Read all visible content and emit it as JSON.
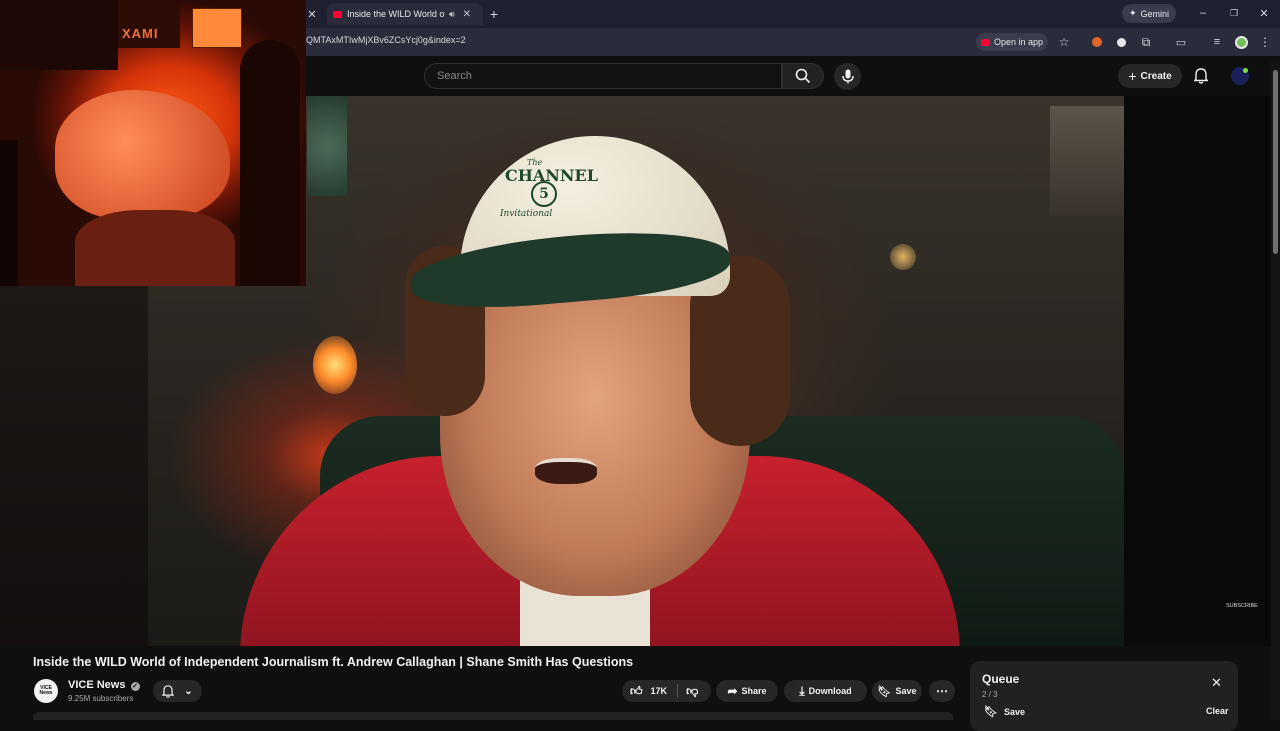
{
  "browser": {
    "tab_title": "Inside the WILD World of Independent Journalism ft. Andrew Callaghan | Shane Smith Has Questions",
    "tab_title_visible": "Inside the WILD World of In",
    "url_visible": "QMTAxMTIwMjXBv6ZCsYcj0g&index=2",
    "gemini_label": "Gemini",
    "open_in_app_label": "Open in app"
  },
  "header": {
    "search_placeholder": "Search",
    "create_label": "Create"
  },
  "video": {
    "cap_text_1": "The",
    "cap_text_2": "CHANNEL",
    "cap_text_3": "5",
    "cap_text_4": "Invitational",
    "subscribe_watermark": "SUBSCRIBE",
    "cam_sign_text": "XAMI"
  },
  "meta": {
    "title": "Inside the WILD World of Independent Journalism ft. Andrew Callaghan | Shane Smith Has Questions",
    "channel_name": "VICE News",
    "channel_avatar_text": "VICE News",
    "subscribers": "9.25M subscribers",
    "like_count": "17K",
    "share_label": "Share",
    "download_label": "Download",
    "save_label": "Save"
  },
  "queue": {
    "title": "Queue",
    "position": "2 / 3",
    "save_label": "Save",
    "clear_label": "Clear"
  },
  "colors": {
    "page_bg": "#0f0f0f",
    "tab_bar_bg": "#1f2030",
    "address_bar_bg": "#2b2c3b",
    "youtube_red": "#ff0033",
    "button_bg": "#272727"
  }
}
